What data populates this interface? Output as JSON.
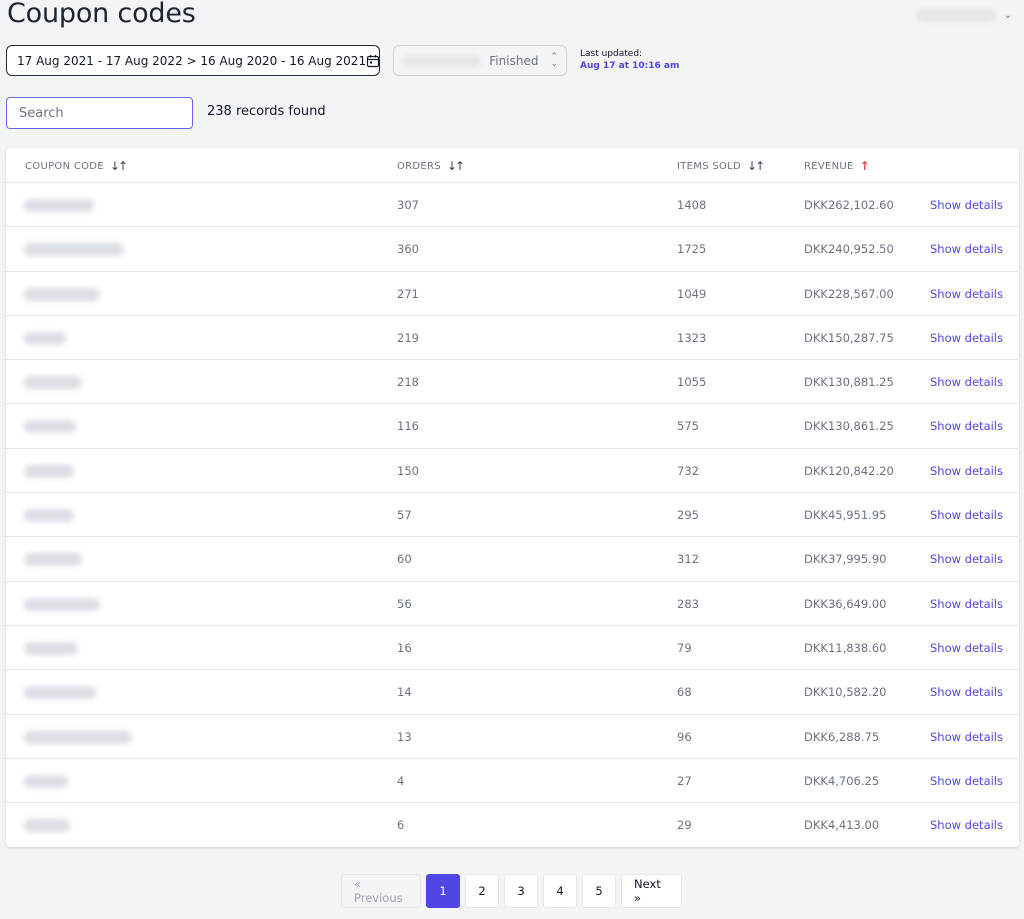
{
  "page": {
    "title": "Coupon codes"
  },
  "filters": {
    "date_range": "17 Aug 2021 - 17 Aug 2022 > 16 Aug 2020 - 16 Aug 2021",
    "status_value": "Finished",
    "last_updated_label": "Last updated:",
    "last_updated_time": "Aug 17 at 10:16 am"
  },
  "search": {
    "placeholder": "Search",
    "value": ""
  },
  "records_found": "238 records found",
  "table": {
    "columns": [
      "COUPON CODE",
      "ORDERS",
      "ITEMS SOLD",
      "REVENUE"
    ],
    "action_label": "Show details",
    "rows": [
      {
        "orders": "307",
        "items_sold": "1408",
        "revenue": "DKK262,102.60"
      },
      {
        "orders": "360",
        "items_sold": "1725",
        "revenue": "DKK240,952.50"
      },
      {
        "orders": "271",
        "items_sold": "1049",
        "revenue": "DKK228,567.00"
      },
      {
        "orders": "219",
        "items_sold": "1323",
        "revenue": "DKK150,287.75"
      },
      {
        "orders": "218",
        "items_sold": "1055",
        "revenue": "DKK130,881.25"
      },
      {
        "orders": "116",
        "items_sold": "575",
        "revenue": "DKK130,861.25"
      },
      {
        "orders": "150",
        "items_sold": "732",
        "revenue": "DKK120,842.20"
      },
      {
        "orders": "57",
        "items_sold": "295",
        "revenue": "DKK45,951.95"
      },
      {
        "orders": "60",
        "items_sold": "312",
        "revenue": "DKK37,995.90"
      },
      {
        "orders": "56",
        "items_sold": "283",
        "revenue": "DKK36,649.00"
      },
      {
        "orders": "16",
        "items_sold": "79",
        "revenue": "DKK11,838.60"
      },
      {
        "orders": "14",
        "items_sold": "68",
        "revenue": "DKK10,582.20"
      },
      {
        "orders": "13",
        "items_sold": "96",
        "revenue": "DKK6,288.75"
      },
      {
        "orders": "4",
        "items_sold": "27",
        "revenue": "DKK4,706.25"
      },
      {
        "orders": "6",
        "items_sold": "29",
        "revenue": "DKK4,413.00"
      }
    ]
  },
  "pagination": {
    "previous": "« Previous",
    "pages": [
      "1",
      "2",
      "3",
      "4",
      "5"
    ],
    "active_page": "1",
    "next": "Next »"
  },
  "colors": {
    "accent": "#4f46e5",
    "sort_active": "#ef4444",
    "background": "#f3f4f6"
  },
  "icons": {
    "date_picker": "calendar-icon",
    "status": "chevron-updown-icon",
    "sort": "sort-arrows-icon",
    "sorted": "arrow-up-icon",
    "account": "chevron-down-icon"
  }
}
